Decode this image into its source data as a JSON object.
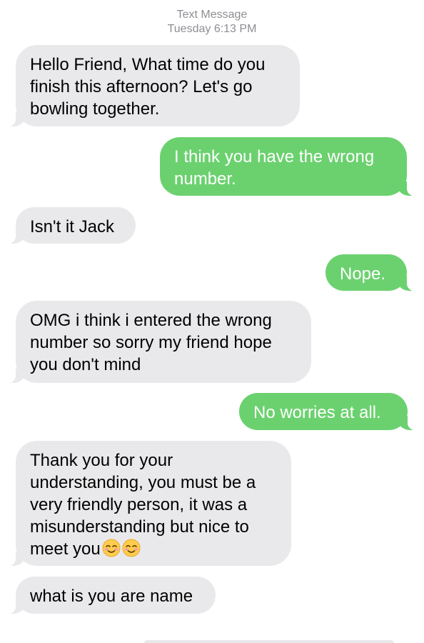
{
  "header": {
    "service": "Text Message",
    "timestamp": "Tuesday 6:13 PM"
  },
  "colors": {
    "incoming_bubble": "#e9e9eb",
    "outgoing_bubble": "#6bd16f",
    "timestamp_text": "#8e8e93"
  },
  "messages": [
    {
      "direction": "incoming",
      "text": "Hello Friend, What time do you finish this afternoon? Let's go bowling together."
    },
    {
      "direction": "outgoing",
      "text": "I think you have the wrong number."
    },
    {
      "direction": "incoming",
      "text": "Isn't it Jack"
    },
    {
      "direction": "outgoing",
      "text": "Nope."
    },
    {
      "direction": "incoming",
      "text": "OMG i think i entered the wrong number so sorry my friend hope you don't mind"
    },
    {
      "direction": "outgoing",
      "text": "No worries at all."
    },
    {
      "direction": "incoming",
      "text": "Thank you for your understanding, you must be a very friendly person, it was a misunderstanding but nice to meet you",
      "emojis": [
        "smiling-face-icon",
        "smiling-face-icon"
      ]
    },
    {
      "direction": "incoming",
      "text": "what is you are name"
    }
  ]
}
